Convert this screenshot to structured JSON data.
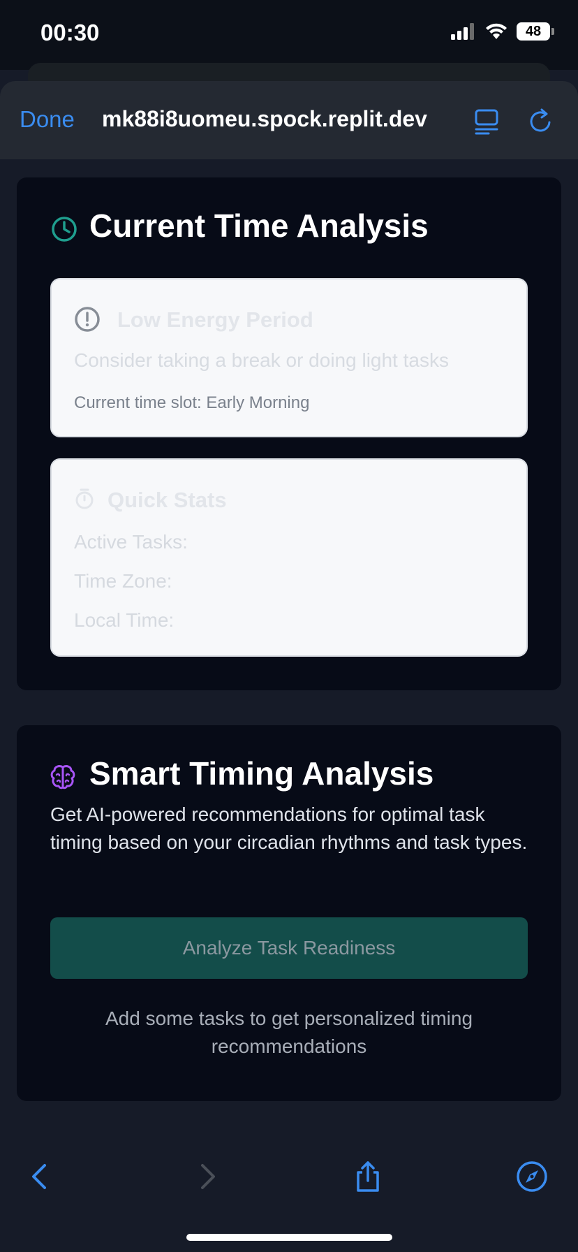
{
  "status_bar": {
    "time": "00:30",
    "battery": "48",
    "icons": [
      "cellular-signal-icon",
      "wifi-icon",
      "battery-icon"
    ]
  },
  "browser": {
    "done_label": "Done",
    "url": "mk88i8uomeu.spock.replit.dev",
    "icons": [
      "reader-mode-icon",
      "reload-icon"
    ],
    "accent_color": "#3a8cf0"
  },
  "current_time_analysis": {
    "title": "Current Time Analysis",
    "icon": "clock-icon",
    "energy_panel": {
      "icon": "alert-circle-icon",
      "title": "Low Energy Period",
      "message": "Consider taking a break or doing light tasks",
      "time_slot": "Current time slot: Early Morning"
    },
    "quick_stats": {
      "icon": "timer-icon",
      "title": "Quick Stats",
      "rows": [
        "Active Tasks:",
        "Time Zone:",
        "Local Time:"
      ]
    }
  },
  "smart_timing": {
    "title": "Smart Timing Analysis",
    "icon": "brain-icon",
    "description": "Get AI-powered recommendations for optimal task timing based on your circadian rhythms and task types.",
    "button_label": "Analyze Task Readiness",
    "hint": "Add some tasks to get personalized timing recommendations"
  },
  "toolbar": {
    "icons": [
      "back-icon",
      "forward-icon",
      "share-icon",
      "compass-icon"
    ]
  }
}
